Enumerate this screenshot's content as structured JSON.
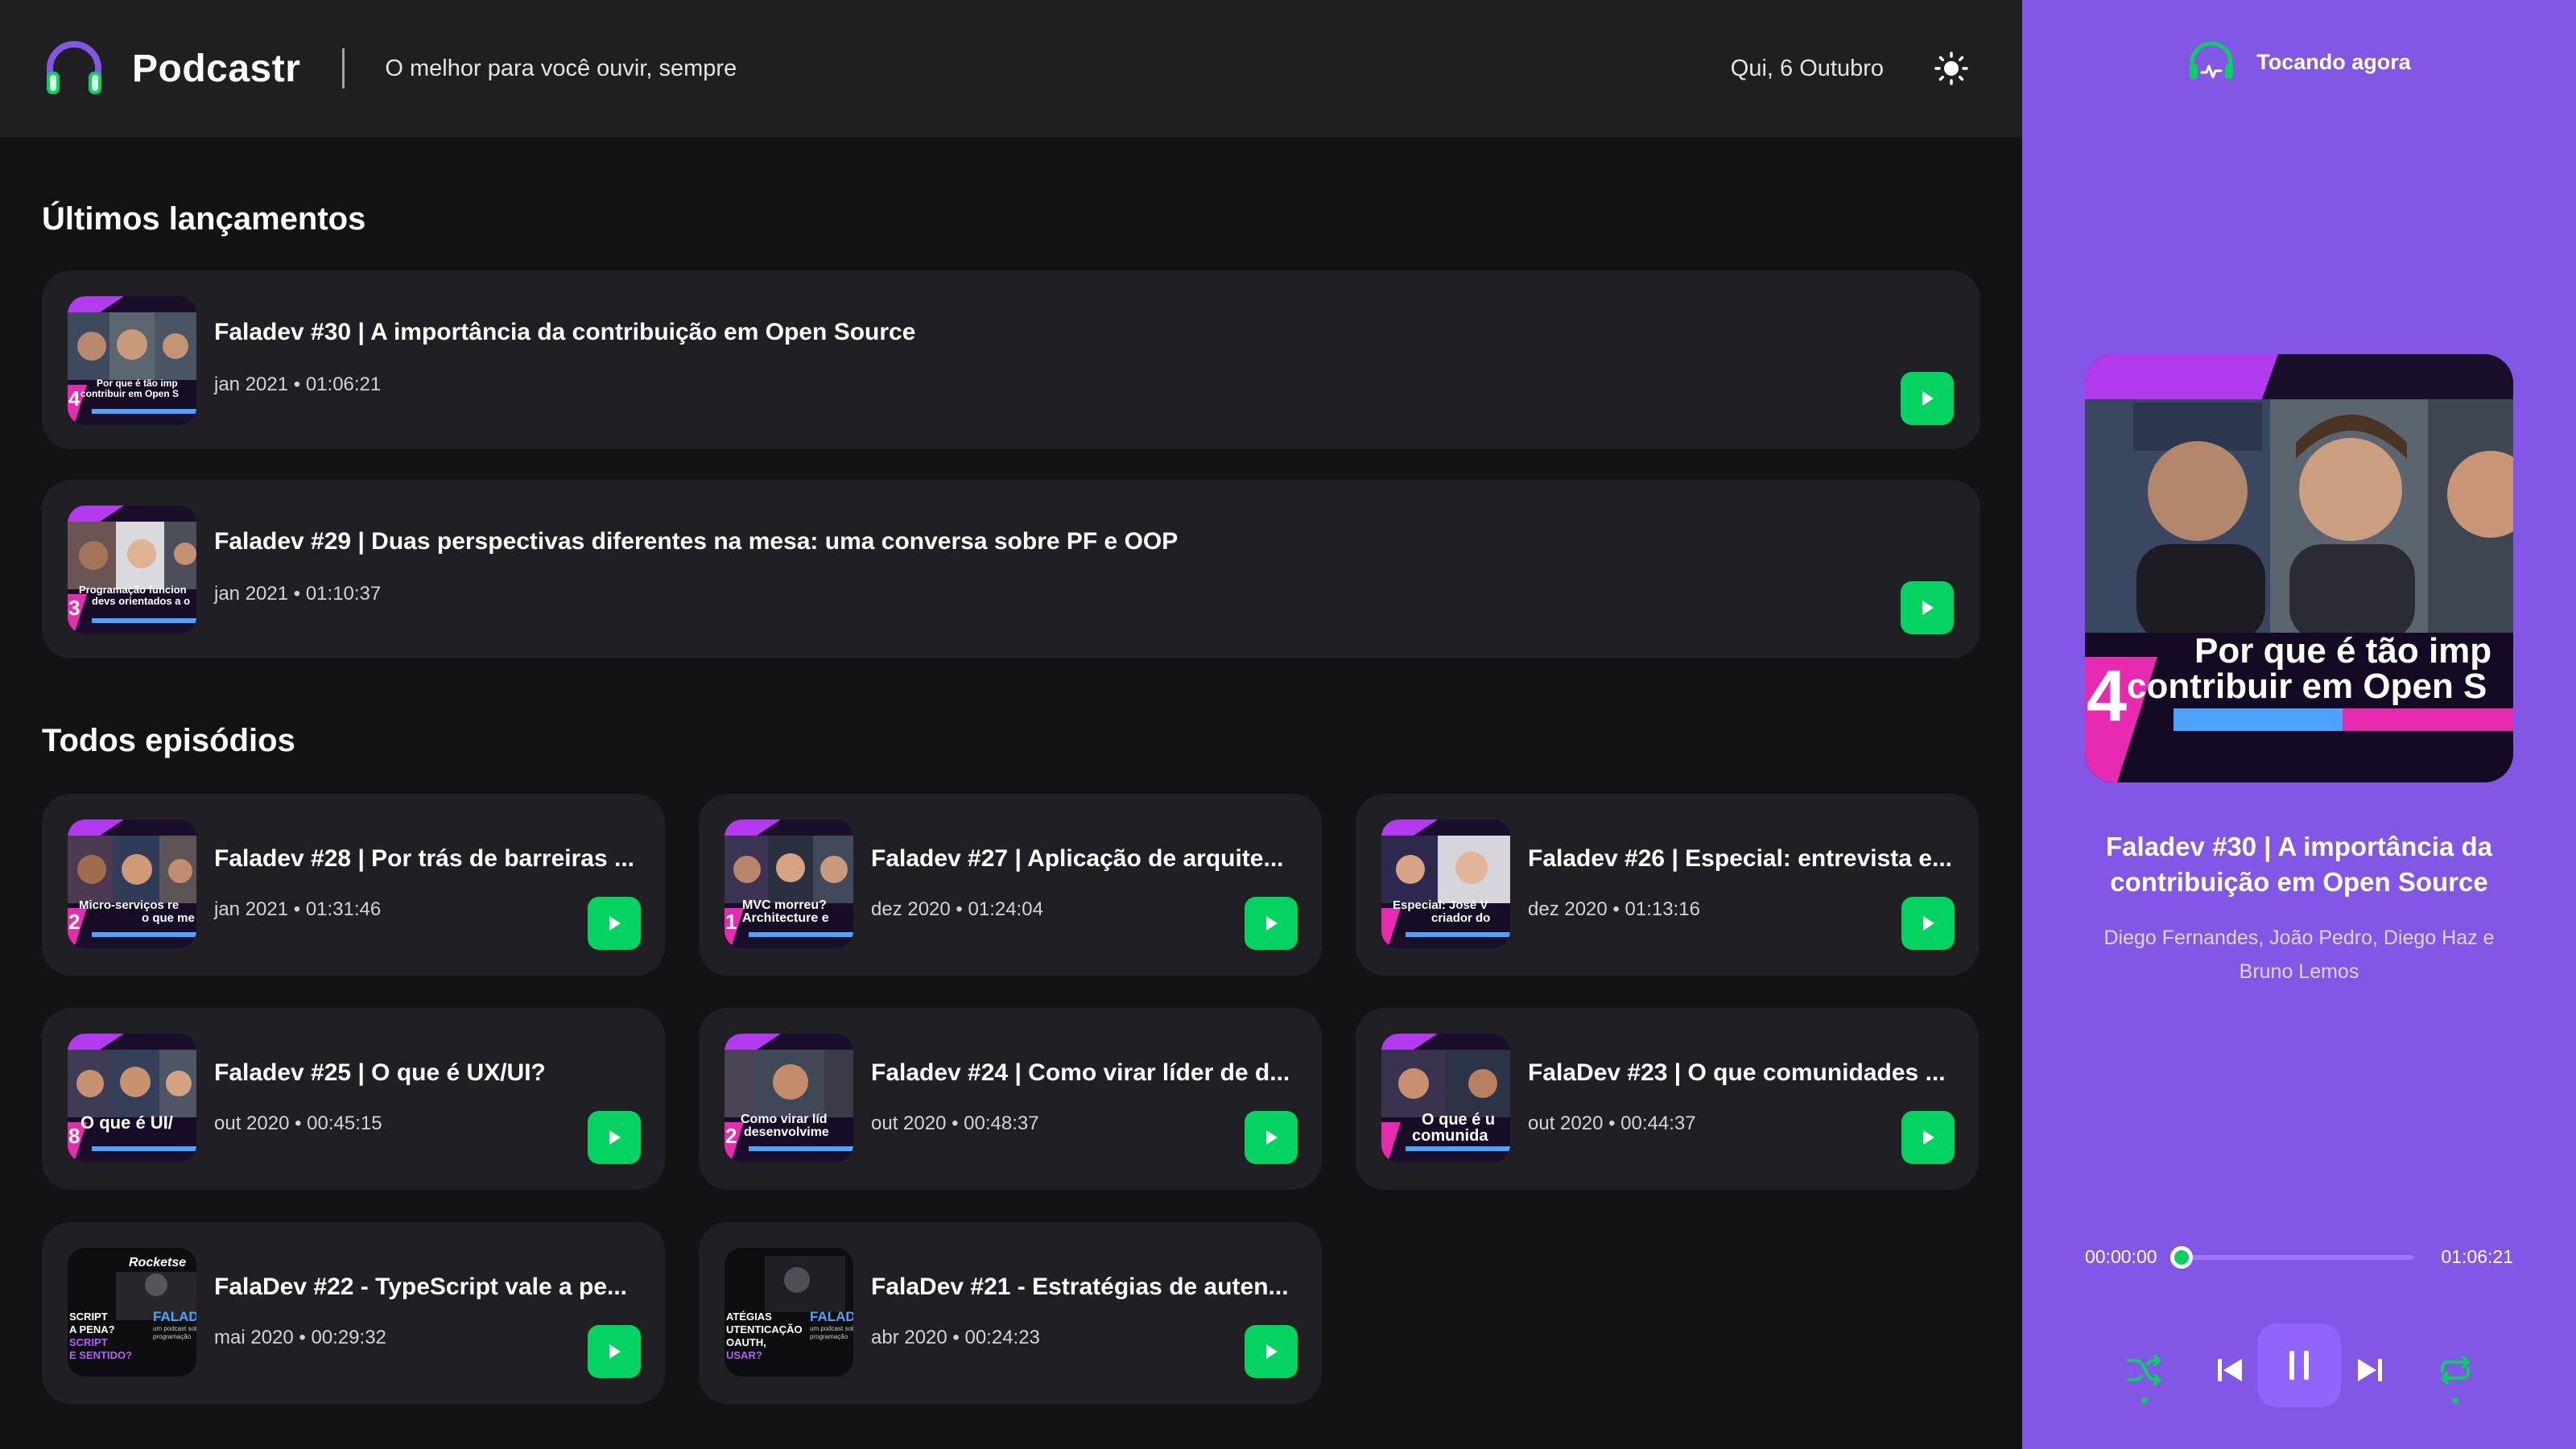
{
  "header": {
    "app_name": "Podcastr",
    "slogan": "O melhor para você ouvir, sempre",
    "date": "Qui, 6 Outubro",
    "logo_icon": "headphones-icon",
    "theme_icon": "sun-icon"
  },
  "latest": {
    "heading": "Últimos lançamentos",
    "episodes": [
      {
        "title": "Faladev #30 | A importância da contribuição em Open Source",
        "meta": "jan 2021 • 01:06:21",
        "thumb_text": [
          "Por que é tão imp",
          "contribuir em Open S"
        ],
        "thumb_number": "4"
      },
      {
        "title": "Faladev #29 | Duas perspectivas diferentes na mesa: uma conversa sobre PF e OOP",
        "meta": "jan 2021 • 01:10:37",
        "thumb_text": [
          "Programação funcion",
          "devs orientados a o"
        ],
        "thumb_number": "3"
      }
    ]
  },
  "all": {
    "heading": "Todos episódios",
    "episodes": [
      {
        "title": "Faladev #28 | Por trás de barreiras ...",
        "meta": "jan 2021 • 01:31:46",
        "thumb_text": [
          "Micro-serviços re",
          "o que me"
        ],
        "thumb_number": "2"
      },
      {
        "title": "Faladev #27 | Aplicação de arquite...",
        "meta": "dez 2020 • 01:24:04",
        "thumb_text": [
          "MVC morreu?",
          "Architecture e"
        ],
        "thumb_number": "1"
      },
      {
        "title": "Faladev #26 | Especial: entrevista e...",
        "meta": "dez 2020 • 01:13:16",
        "thumb_text": [
          "Especial: José V",
          "criador do"
        ],
        "thumb_number": ""
      },
      {
        "title": "Faladev #25 | O que é UX/UI?",
        "meta": "out 2020 • 00:45:15",
        "thumb_text": [
          "O que é UI/",
          ""
        ],
        "thumb_number": "8"
      },
      {
        "title": "Faladev #24 | Como virar líder de d...",
        "meta": "out 2020 • 00:48:37",
        "thumb_text": [
          "Como virar líd",
          "desenvolvime"
        ],
        "thumb_number": "2"
      },
      {
        "title": "FalaDev #23 | O que comunidades ...",
        "meta": "out 2020 • 00:44:37",
        "thumb_text": [
          "O que é u",
          "comunida"
        ],
        "thumb_number": ""
      },
      {
        "title": "FalaDev #22 - TypeScript vale a pe...",
        "meta": "mai 2020 • 00:29:32",
        "thumb_text": [
          "SCRIPT",
          "A PENA?",
          "SCRIPT",
          "E SENTIDO?"
        ],
        "thumb_brand": "Rocketse",
        "thumb_tag": "FALAD",
        "thumb_small": [
          "um podcast sobr",
          "programação"
        ]
      },
      {
        "title": "FalaDev #21 - Estratégias de auten...",
        "meta": "abr 2020 • 00:24:23",
        "thumb_text": [
          "ATÉGIAS",
          "UTENTICAÇÃO",
          "OAUTH,",
          "USAR?"
        ],
        "thumb_tag": "FALAD",
        "thumb_small": [
          "um podcast sob",
          "programação"
        ]
      }
    ]
  },
  "player": {
    "heading": "Tocando agora",
    "heading_icon": "playing-now-icon",
    "title": "Faladev #30 | A importância da contribuição em Open Source",
    "members": "Diego Fernandes, João Pedro, Diego Haz e Bruno Lemos",
    "cover_text": [
      "Por que é tão imp",
      "contribuir em Open S"
    ],
    "cover_number": "4",
    "current_time": "00:00:00",
    "duration": "01:06:21",
    "progress": 0.0,
    "controls": [
      "shuffle-icon",
      "previous-icon",
      "pause-icon",
      "next-icon",
      "repeat-icon"
    ],
    "accent": "#04d361",
    "background": "#8257e5"
  }
}
